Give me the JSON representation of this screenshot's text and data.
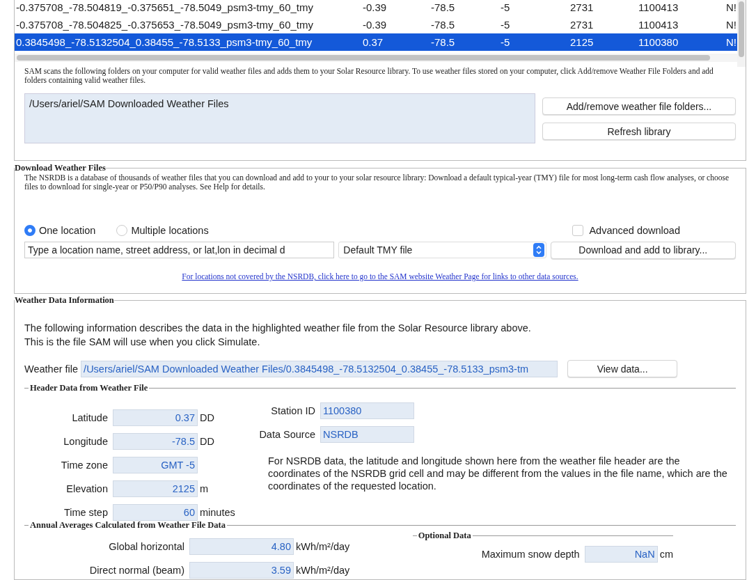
{
  "weather_table": {
    "rows": [
      {
        "cells": [
          "-0.375708_-78.504819_-0.375651_-78.5049_psm3-tmy_60_tmy",
          "-0.39",
          "-78.5",
          "-5",
          "2731",
          "1100413",
          "N!"
        ],
        "selected": false
      },
      {
        "cells": [
          "-0.375708_-78.504825_-0.375653_-78.5049_psm3-tmy_60_tmy",
          "-0.39",
          "-78.5",
          "-5",
          "2731",
          "1100413",
          "N!"
        ],
        "selected": false
      },
      {
        "cells": [
          "0.3845498_-78.5132504_0.38455_-78.5133_psm3-tmy_60_tmy",
          "0.37",
          "-78.5",
          "-5",
          "2125",
          "1100380",
          "N!"
        ],
        "selected": true
      }
    ]
  },
  "library_note": "SAM scans the following folders on your computer for valid weather files and adds them to your Solar Resource library. To use weather files stored on your computer, click Add/remove Weather File Folders and add folders containing valid weather files.",
  "folders": [
    "/Users/ariel/SAM Downloaded Weather Files"
  ],
  "library_buttons": [
    "Add/remove weather file folders...",
    "Refresh library"
  ],
  "download": {
    "title": "Download Weather Files",
    "description": "The NSRDB is a database of thousands of weather files that you can download and add to your to your solar resource library: Download a default typical-year (TMY) file for most long-term cash flow analyses, or choose files to download for single-year or P50/P90 analyses. See Help for details.",
    "modes": [
      {
        "label": "One location",
        "selected": true
      },
      {
        "label": "Multiple locations",
        "selected": false
      }
    ],
    "advanced": {
      "label": "Advanced download",
      "checked": false
    },
    "location_field": {
      "value": "Type a location name, street address, or lat,lon in decimal d"
    },
    "file_type": "Default TMY file",
    "download_button": "Download and add to library...",
    "link": "For locations not covered by the NSRDB, click here to go to the SAM website Weather Page for links to other data sources."
  },
  "info": {
    "title": "Weather Data Information",
    "description": "The following information describes the data in the highlighted weather file from the Solar Resource library above. This is the file SAM will use when you click Simulate.",
    "weather_file": {
      "label": "Weather file",
      "value": "/Users/ariel/SAM Downloaded Weather Files/0.3845498_-78.5132504_0.38455_-78.5133_psm3-tm"
    },
    "view_button": "View data...",
    "header": {
      "title": "Header Data from Weather File",
      "left_fields": [
        {
          "label": "Latitude",
          "value": "0.37",
          "unit": "DD"
        },
        {
          "label": "Longitude",
          "value": "-78.5",
          "unit": "DD"
        },
        {
          "label": "Time zone",
          "value": "GMT -5"
        },
        {
          "label": "Elevation",
          "value": "2125",
          "unit": "m"
        },
        {
          "label": "Time step",
          "value": "60",
          "unit": "minutes"
        }
      ],
      "right_fields": [
        {
          "label": "Station ID",
          "value": "1100380"
        },
        {
          "label": "Data Source",
          "value": "NSRDB"
        }
      ],
      "note": "For NSRDB data, the latitude and longitude shown here from the weather file header are the coordinates of the NSRDB grid cell and may be different from the values in the file name, which are the coordinates of the requested location."
    },
    "annual": {
      "title": "Annual Averages Calculated from Weather File  Data",
      "fields": [
        {
          "label": "Global horizontal",
          "value": "4.80",
          "unit": "kWh/m²/day"
        },
        {
          "label": "Direct normal (beam)",
          "value": "3.59",
          "unit": "kWh/m²/day"
        }
      ]
    },
    "optional": {
      "title": "Optional Data",
      "fields": [
        {
          "label": "Maximum snow depth",
          "value": "NaN",
          "unit": "cm"
        }
      ]
    }
  }
}
